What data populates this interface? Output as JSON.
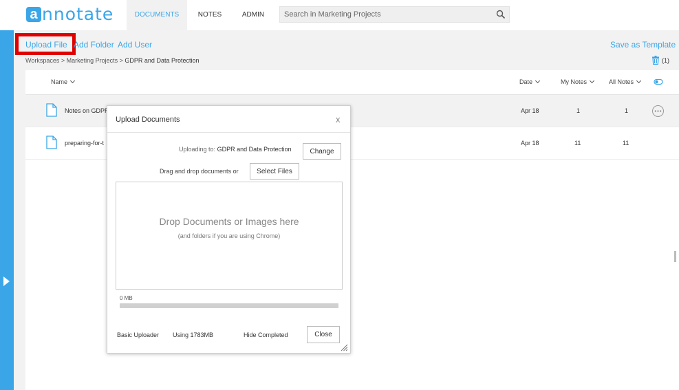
{
  "app": {
    "logo_letter": "a",
    "logo_text": "nnotate"
  },
  "nav": {
    "tabs": [
      {
        "label": "DOCUMENTS"
      },
      {
        "label": "NOTES"
      },
      {
        "label": "ADMIN"
      }
    ],
    "search_placeholder": "Search in Marketing Projects",
    "search_icon": "search-icon"
  },
  "actions": {
    "upload_file": "Upload File",
    "add_folder": "Add Folder",
    "add_user": "Add User",
    "save_template": "Save as Template"
  },
  "breadcrumb": {
    "workspaces": "Workspaces",
    "sep1": " > ",
    "project": "Marketing Projects",
    "sep2": " > ",
    "current": "GDPR and Data Protection"
  },
  "trash": {
    "count": "(1)",
    "icon": "trash-icon"
  },
  "table": {
    "headers": {
      "name": "Name",
      "date": "Date",
      "my_notes": "My Notes",
      "all_notes": "All Notes"
    },
    "rows": [
      {
        "name": "Notes on GDPR",
        "date": "Apr 18",
        "my_notes": "1",
        "all_notes": "1"
      },
      {
        "name": "preparing-for-t",
        "date": "Apr 18",
        "my_notes": "11",
        "all_notes": "11"
      }
    ]
  },
  "modal": {
    "title": "Upload Documents",
    "close": "x",
    "uploading_prefix": "Uploading to:",
    "uploading_target": "GDPR and Data Protection",
    "change_button": "Change",
    "drag_text": "Drag and drop documents or",
    "select_files": "Select Files",
    "drop_main": "Drop Documents or Images here",
    "drop_sub": "(and folders if you are using Chrome)",
    "mb_label": "0 MB",
    "progress_fraction": 0,
    "basic_uploader": "Basic Uploader",
    "using": "Using 1783MB",
    "hide_completed": "Hide Completed",
    "close_button": "Close"
  },
  "colors": {
    "accent": "#3aa6e8",
    "highlight": "#e00000"
  }
}
